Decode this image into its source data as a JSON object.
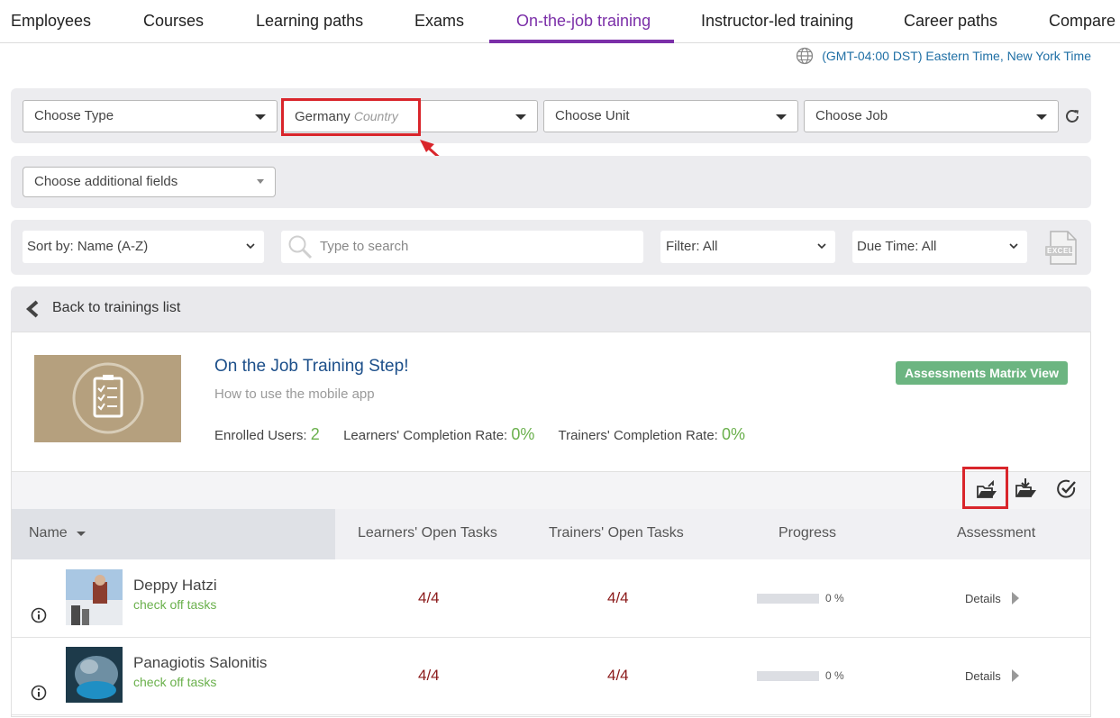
{
  "nav": {
    "tabs": [
      "Employees",
      "Courses",
      "Learning paths",
      "Exams",
      "On-the-job training",
      "Instructor-led training",
      "Career paths",
      "Compare"
    ],
    "active": "On-the-job training"
  },
  "timezone": "(GMT-04:00 DST) Eastern Time, New York Time",
  "filters": {
    "type": "Choose Type",
    "country_value": "Germany",
    "country_hint": "Country",
    "unit": "Choose Unit",
    "job": "Choose Job",
    "additional": "Choose additional fields"
  },
  "toolbar": {
    "sort": "Sort by: Name (A-Z)",
    "search_placeholder": "Type to search",
    "filter": "Filter: All",
    "due": "Due Time: All",
    "excel_label": "EXCEL"
  },
  "back_label": "Back to trainings list",
  "training": {
    "title": "On the Job Training Step!",
    "subtitle": "How to use the mobile app",
    "enrolled_label": "Enrolled Users:",
    "enrolled_value": "2",
    "learners_rate_label": "Learners' Completion Rate:",
    "learners_rate_value": "0%",
    "trainers_rate_label": "Trainers' Completion Rate:",
    "trainers_rate_value": "0%",
    "matrix_button": "Assessments Matrix View"
  },
  "table": {
    "headers": [
      "Name",
      "Learners' Open Tasks",
      "Trainers' Open Tasks",
      "Progress",
      "Assessment"
    ],
    "rows": [
      {
        "name": "Deppy Hatzi",
        "link": "check off tasks",
        "learners": "4/4",
        "trainers": "4/4",
        "progress": 0,
        "progress_text": "0 %",
        "assessment": "Details"
      },
      {
        "name": "Panagiotis Salonitis",
        "link": "check off tasks",
        "learners": "4/4",
        "trainers": "4/4",
        "progress": 0,
        "progress_text": "0 %",
        "assessment": "Details"
      }
    ]
  },
  "colors": {
    "accent": "#7b2fa8",
    "highlight": "#d9252b",
    "green": "#6ab04c",
    "link": "#1c4f8a"
  }
}
